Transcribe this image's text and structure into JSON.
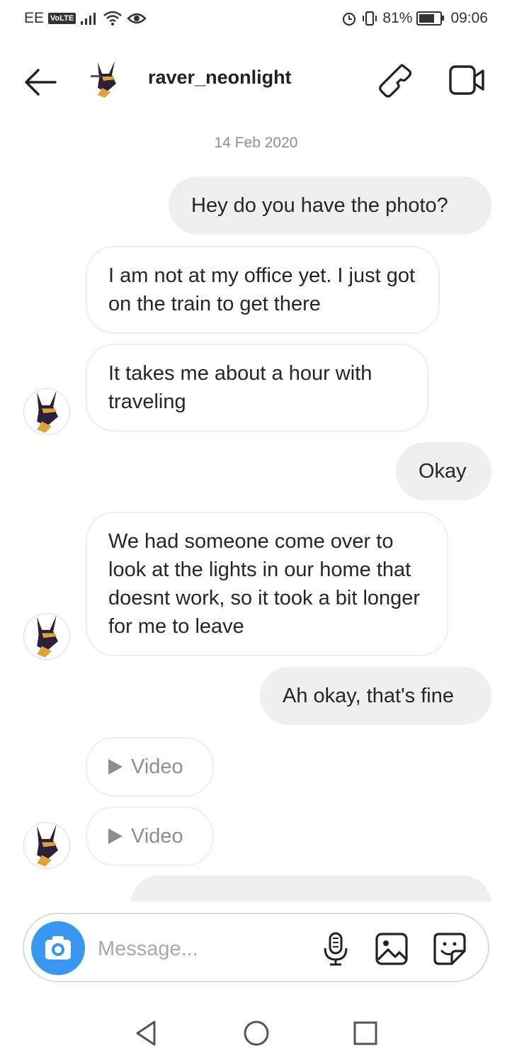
{
  "status_bar": {
    "carrier": "EE",
    "volte": "VoLTE",
    "battery": "81%",
    "battery_level": 0.81,
    "time": "09:06"
  },
  "header": {
    "username": "raver_neonlight",
    "icons": [
      "back-arrow-icon",
      "phone-icon",
      "video-camera-icon"
    ]
  },
  "chat": {
    "date": "14 Feb 2020",
    "messages": [
      {
        "direction": "outgoing",
        "text": "Hey do you have the photo?"
      },
      {
        "direction": "incoming",
        "text": "I am not at my office yet. I just got on the train to get there"
      },
      {
        "direction": "incoming",
        "text": "It takes me about a hour with traveling"
      },
      {
        "direction": "outgoing",
        "text": "Okay"
      },
      {
        "direction": "incoming",
        "text": "We had someone come over to look at the lights in our home that doesnt work, so it took a bit longer for me to leave"
      },
      {
        "direction": "outgoing",
        "text": "Ah okay, that's fine"
      },
      {
        "direction": "incoming",
        "text": "Video"
      },
      {
        "direction": "incoming",
        "text": "Video"
      }
    ]
  },
  "composer": {
    "placeholder": "Message..."
  },
  "colors": {
    "accent": "#3897f0",
    "outgoing_bubble": "#efefef",
    "muted_text": "#8e8e8e"
  }
}
